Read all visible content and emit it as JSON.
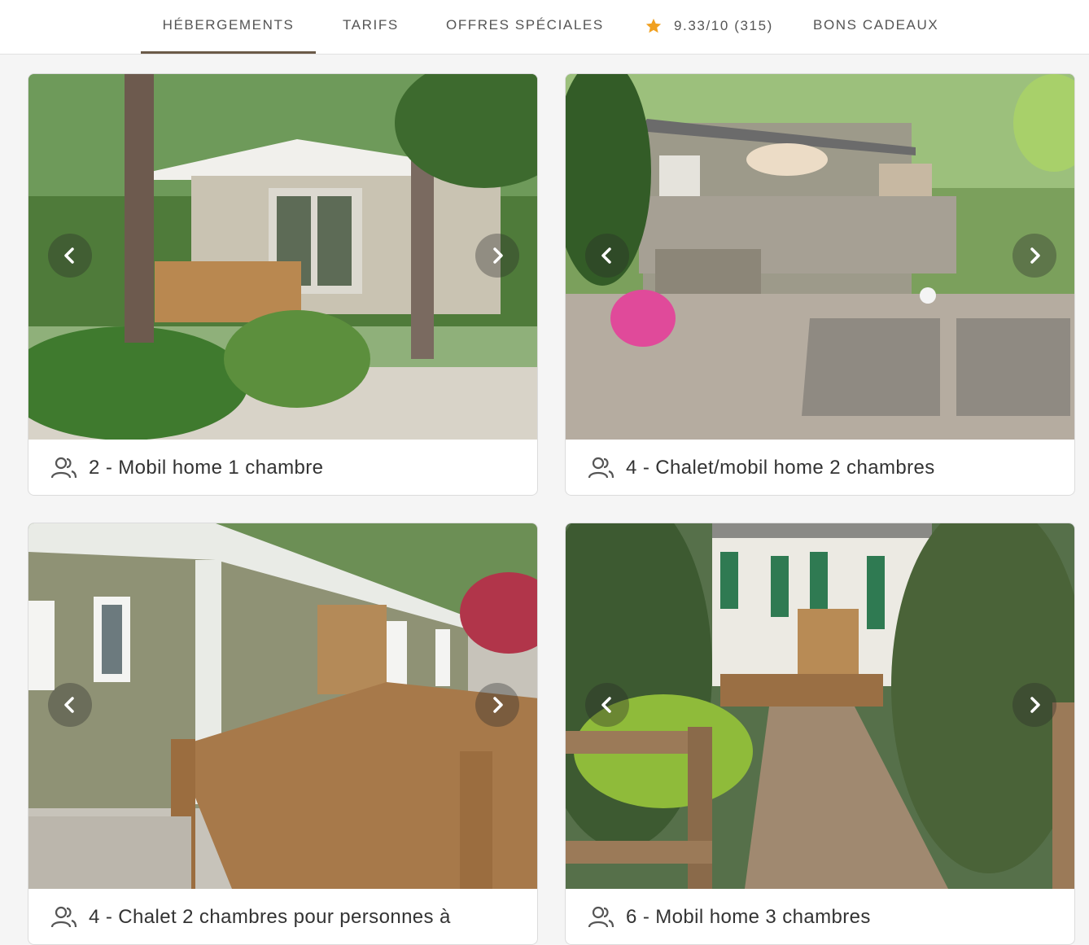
{
  "nav": {
    "items": [
      {
        "label": "HÉBERGEMENTS",
        "active": true
      },
      {
        "label": "TARIFS"
      },
      {
        "label": "OFFRES SPÉCIALES"
      },
      {
        "label": "BONS CADEAUX"
      }
    ],
    "rating": {
      "icon": "star-icon",
      "text": "9.33/10 (315)",
      "star_color": "#f0a020"
    },
    "active_underline_color": "#6b5a48"
  },
  "cards": [
    {
      "title": "2 - Mobil home 1 chambre",
      "icon": "people-icon"
    },
    {
      "title": "4 - Chalet/mobil home 2 chambres",
      "icon": "people-icon"
    },
    {
      "title": "4 - Chalet 2 chambres pour personnes à",
      "icon": "people-icon"
    },
    {
      "title": "6 - Mobil home 3 chambres",
      "icon": "people-icon"
    }
  ],
  "carousel": {
    "prev_icon": "chevron-left-icon",
    "next_icon": "chevron-right-icon"
  }
}
